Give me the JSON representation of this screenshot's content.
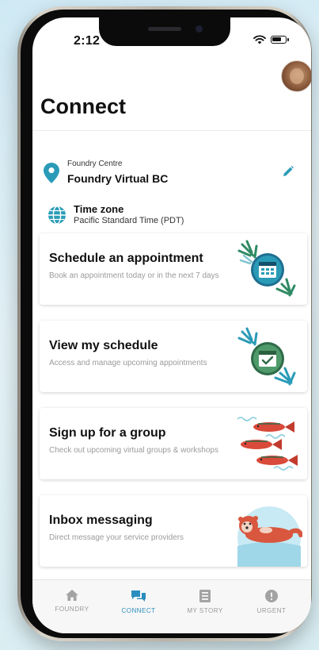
{
  "status_bar": {
    "time": "2:12"
  },
  "header": {
    "title": "Connect"
  },
  "location": {
    "caption": "Foundry Centre",
    "name": "Foundry Virtual BC"
  },
  "timezone": {
    "label": "Time zone",
    "value": "Pacific Standard Time (PDT)"
  },
  "cards": [
    {
      "title": "Schedule an appointment",
      "description": "Book an appointment today or in the next 7 days",
      "icon": "calendar-icon"
    },
    {
      "title": "View my schedule",
      "description": "Access and manage upcoming appointments",
      "icon": "calendar-check-icon"
    },
    {
      "title": "Sign up for a group",
      "description": "Check out upcoming virtual groups & workshops",
      "icon": "salmon-illustration"
    },
    {
      "title": "Inbox messaging",
      "description": "Direct message your service providers",
      "icon": "otter-illustration"
    }
  ],
  "tabs": [
    {
      "label": "FOUNDRY",
      "icon": "home-icon",
      "active": false
    },
    {
      "label": "CONNECT",
      "icon": "chat-bubbles-icon",
      "active": true
    },
    {
      "label": "MY STORY",
      "icon": "journal-icon",
      "active": false
    },
    {
      "label": "URGENT",
      "icon": "alert-icon",
      "active": false
    }
  ],
  "colors": {
    "accent": "#2b8dbe",
    "teal": "#2a9bb7",
    "green": "#3f8a5e",
    "salmon": "#d94a3a"
  }
}
